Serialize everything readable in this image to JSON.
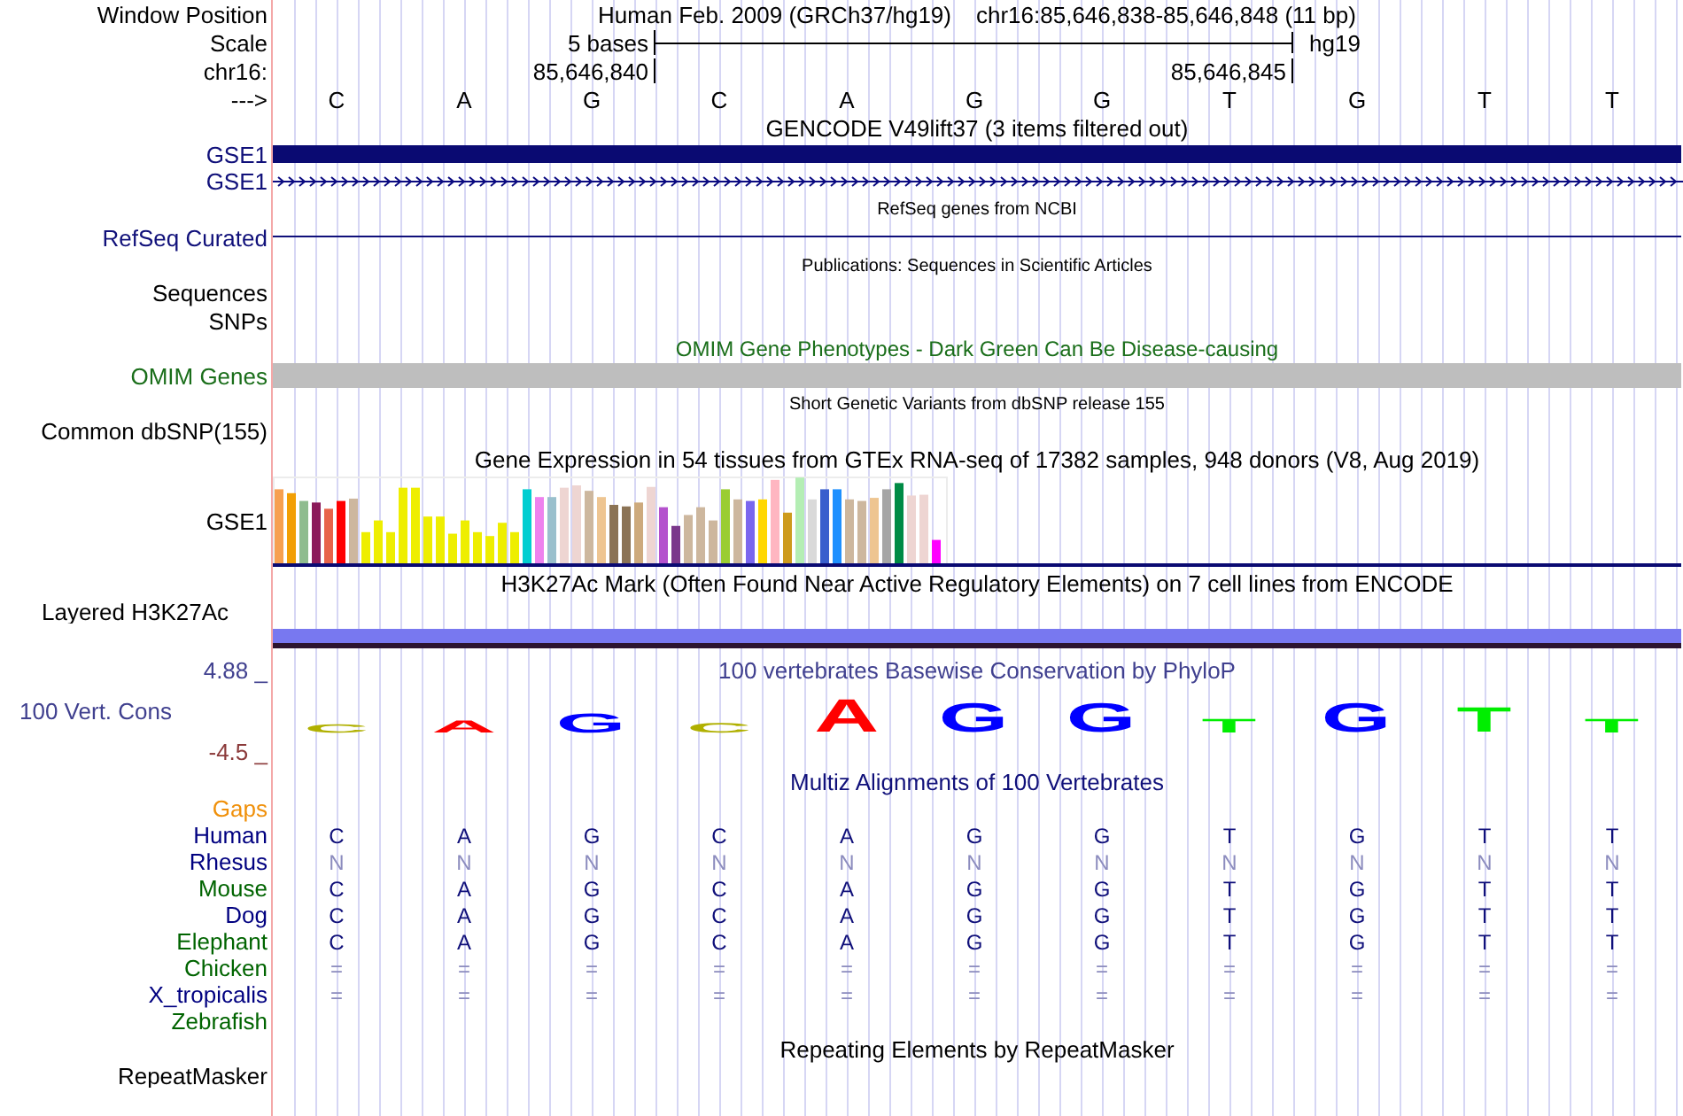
{
  "position": {
    "label": "Window Position",
    "assembly": "Human Feb. 2009 (GRCh37/hg19)",
    "range": "chr16:85,646,838-85,646,848 (11 bp)"
  },
  "scale": {
    "label": "Scale",
    "span": "5 bases",
    "assembly": "hg19"
  },
  "coordinates": {
    "label": "chr16:",
    "start": "85,646,840",
    "end": "85,646,845"
  },
  "sequence": {
    "label": "--->",
    "bases": [
      "C",
      "A",
      "G",
      "C",
      "A",
      "G",
      "G",
      "T",
      "G",
      "T",
      "T"
    ]
  },
  "tracks": [
    {
      "kind": "gene",
      "title": "GENCODE V49lift37 (3 items filtered out)",
      "rows": [
        {
          "label": "GSE1",
          "kind": "block"
        },
        {
          "label": "GSE1",
          "kind": "arrows"
        }
      ]
    },
    {
      "kind": "line",
      "title": "RefSeq genes from NCBI",
      "label": "RefSeq Curated"
    },
    {
      "kind": "publication",
      "title": "Publications: Sequences in Scientific Articles",
      "labels": [
        "Sequences",
        "SNPs"
      ]
    },
    {
      "kind": "bar",
      "title": "OMIM Gene Phenotypes - Dark Green Can Be Disease-causing",
      "label": "OMIM Genes"
    },
    {
      "kind": "variants",
      "title": "Short Genetic Variants from dbSNP release 155",
      "labels": [
        "Common dbSNP(155)"
      ]
    },
    {
      "kind": "expression",
      "title": "Gene Expression in 54 tissues from GTEx RNA-seq of 17382 samples, 948 donors (V8, Aug 2019)",
      "label": "GSE1"
    },
    {
      "kind": "layered",
      "title": "H3K27Ac Mark (Often Found Near Active Regulatory Elements) on 7 cell lines from ENCODE",
      "label": "Layered H3K27Ac"
    },
    {
      "kind": "conservation",
      "title": "100 vertebrates Basewise Conservation by PhyloP",
      "label": "100 Vert. Cons",
      "max": "4.88 _",
      "min": "-4.5 _",
      "logo": [
        {
          "base": "C",
          "color": "#b0b000"
        },
        {
          "base": "A",
          "color": "#ff0000"
        },
        {
          "base": "G",
          "color": "#0000ff"
        },
        {
          "base": "C",
          "color": "#b0b000"
        },
        {
          "base": "A",
          "color": "#ff0000"
        },
        {
          "base": "G",
          "color": "#0000ff"
        },
        {
          "base": "G",
          "color": "#0000ff"
        },
        {
          "base": "T",
          "color": "#00ee00"
        },
        {
          "base": "G",
          "color": "#0000ff"
        },
        {
          "base": "T",
          "color": "#00ee00"
        },
        {
          "base": "T",
          "color": "#00ee00"
        }
      ]
    },
    {
      "kind": "alignment",
      "title": "Multiz Alignments of 100 Vertebrates",
      "species": [
        {
          "label": "Gaps",
          "color": "#f0900a"
        },
        {
          "label": "Human",
          "color": "#000080",
          "kind": "aligned",
          "bases": [
            "C",
            "A",
            "G",
            "C",
            "A",
            "G",
            "G",
            "T",
            "G",
            "T",
            "T"
          ]
        },
        {
          "label": "Rhesus",
          "color": "#000080",
          "kind": "unaligned",
          "bases": [
            "N",
            "N",
            "N",
            "N",
            "N",
            "N",
            "N",
            "N",
            "N",
            "N",
            "N"
          ]
        },
        {
          "label": "Mouse",
          "color": "#006400",
          "kind": "aligned",
          "bases": [
            "C",
            "A",
            "G",
            "C",
            "A",
            "G",
            "G",
            "T",
            "G",
            "T",
            "T"
          ]
        },
        {
          "label": "Dog",
          "color": "#000080",
          "kind": "aligned",
          "bases": [
            "C",
            "A",
            "G",
            "C",
            "A",
            "G",
            "G",
            "T",
            "G",
            "T",
            "T"
          ]
        },
        {
          "label": "Elephant",
          "color": "#006400",
          "kind": "aligned",
          "bases": [
            "C",
            "A",
            "G",
            "C",
            "A",
            "G",
            "G",
            "T",
            "G",
            "T",
            "T"
          ]
        },
        {
          "label": "Chicken",
          "color": "#006400",
          "kind": "unaligned",
          "bases": [
            "=",
            "=",
            "=",
            "=",
            "=",
            "=",
            "=",
            "=",
            "=",
            "=",
            "="
          ]
        },
        {
          "label": "X_tropicalis",
          "color": "#000080",
          "kind": "unaligned",
          "bases": [
            "=",
            "=",
            "=",
            "=",
            "=",
            "=",
            "=",
            "=",
            "=",
            "=",
            "="
          ]
        },
        {
          "label": "Zebrafish",
          "color": "#006400"
        }
      ]
    },
    {
      "kind": "repeat",
      "title": "Repeating Elements by RepeatMasker",
      "labels": [
        "RepeatMasker"
      ]
    }
  ]
}
